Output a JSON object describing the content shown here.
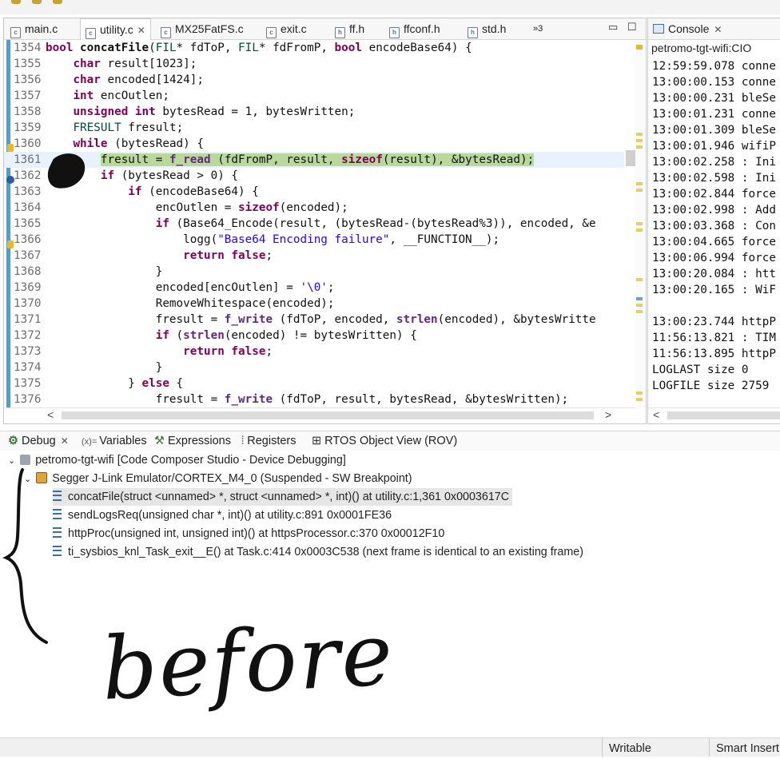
{
  "editor": {
    "tabs": [
      {
        "label": "main.c",
        "active": false
      },
      {
        "label": "utility.c",
        "active": true
      },
      {
        "label": "MX25FatFS.c",
        "active": false
      },
      {
        "label": "exit.c",
        "active": false
      },
      {
        "label": "ff.h",
        "active": false
      },
      {
        "label": "ffconf.h",
        "active": false
      },
      {
        "label": "std.h",
        "active": false
      }
    ],
    "overflow_label": "»3",
    "lines": [
      {
        "num": "1354",
        "html": "<span class='kw'>bool</span> <span class='fn'>concatFile</span>(<span class='ty'>FIL</span>* fdToP, <span class='ty'>FIL</span>* fdFromP, <span class='kw'>bool</span> encodeBase64) {"
      },
      {
        "num": "1355",
        "html": "    <span class='kw'>char</span> result[1023];"
      },
      {
        "num": "1356",
        "html": "    <span class='kw'>char</span> encoded[1424];"
      },
      {
        "num": "1357",
        "html": "    <span class='kw'>int</span> encOutlen;"
      },
      {
        "num": "1358",
        "html": "    <span class='kw'>unsigned int</span> bytesRead = 1, bytesWritten;"
      },
      {
        "num": "1359",
        "html": "    <span class='ty'>FRESULT</span> fresult;"
      },
      {
        "num": "1360",
        "html": "    <span class='kw'>while</span> (bytesRead) {"
      },
      {
        "num": "1361",
        "html": "        <span class='bphl'>fresult = <span class='call'>f_read</span> (fdFromP, result, <span class='kw'>sizeof</span>(result), &amp;bytesRead);</span>"
      },
      {
        "num": "1362",
        "html": "        <span class='kw'>if</span> (bytesRead &gt; 0) {"
      },
      {
        "num": "1363",
        "html": "            <span class='kw'>if</span> (encodeBase64) {"
      },
      {
        "num": "1364",
        "html": "                encOutlen = <span class='kw'>sizeof</span>(encoded);"
      },
      {
        "num": "1365",
        "html": "                <span class='kw'>if</span> (Base64_Encode(result, (bytesRead-(bytesRead%3)), encoded, &amp;e"
      },
      {
        "num": "1366",
        "html": "                    logg(<span class='str'>\"Base64 Encoding failure\"</span>, __FUNCTION__);"
      },
      {
        "num": "1367",
        "html": "                    <span class='kw'>return false</span>;"
      },
      {
        "num": "1368",
        "html": "                }"
      },
      {
        "num": "1369",
        "html": "                encoded[encOutlen] = <span class='str'>'\\0'</span>;"
      },
      {
        "num": "1370",
        "html": "                RemoveWhitespace(encoded);"
      },
      {
        "num": "1371",
        "html": "                fresult = <span class='call'>f_write</span> (fdToP, encoded, <span class='call'>strlen</span>(encoded), &amp;bytesWritte"
      },
      {
        "num": "1372",
        "html": "                <span class='kw'>if</span> (<span class='call'>strlen</span>(encoded) != bytesWritten) {"
      },
      {
        "num": "1373",
        "html": "                    <span class='kw'>return false</span>;"
      },
      {
        "num": "1374",
        "html": "                }"
      },
      {
        "num": "1375",
        "html": "            } <span class='kw'>else</span> {"
      },
      {
        "num": "1376",
        "html": "                fresult = <span class='call'>f_write</span> (fdToP, result, bytesRead, &amp;bytesWritten);"
      }
    ]
  },
  "console": {
    "tab_label": "Console",
    "name": "petromo-tgt-wifi:CIO",
    "lines": [
      "12:59:59.078 conne",
      "13:00:00.153 conne",
      "13:00:00.231 bleSe",
      "13:00:01.231 conne",
      "13:00:01.309 bleSe",
      "13:00:01.946 wifiP",
      "13:00:02.258 : Ini",
      "13:00:02.598 : Ini",
      "13:00:02.844 force",
      "13:00:02.998 : Add",
      "13:00:03.368 : Con",
      "13:00:04.665 force",
      "13:00:06.994 force",
      "13:00:20.084 : htt",
      "13:00:20.165 : WiF",
      "",
      "13:00:23.744 httpP",
      "11:56:13.821 : TIM",
      "11:56:13.895 httpP",
      "LOGLAST size 0",
      "LOGFILE size 2759"
    ]
  },
  "debug": {
    "tabs": [
      {
        "label": "Debug",
        "glyph": "⚙"
      },
      {
        "label": "Variables",
        "glyph": "(x)="
      },
      {
        "label": "Expressions",
        "glyph": "⚒"
      },
      {
        "label": "Registers",
        "glyph": "⦙"
      },
      {
        "label": "RTOS Object View (ROV)",
        "glyph": "⊞"
      }
    ],
    "session": "petromo-tgt-wifi [Code Composer Studio - Device Debugging]",
    "target": "Segger J-Link Emulator/CORTEX_M4_0 (Suspended - SW Breakpoint)",
    "frames": [
      "concatFile(struct <unnamed> *, struct <unnamed> *, int)() at utility.c:1,361 0x0003617C",
      "sendLogsReq(unsigned char *, int)() at utility.c:891 0x0001FE36",
      "httpProc(unsigned int, unsigned int)() at httpsProcessor.c:370 0x00012F10",
      "ti_sysbios_knl_Task_exit__E() at Task.c:414 0x0003C538  (next frame is identical to an existing frame)"
    ]
  },
  "status": {
    "mode": "Writable",
    "insert": "Smart Insert"
  },
  "annotation": {
    "handwritten": "before"
  }
}
